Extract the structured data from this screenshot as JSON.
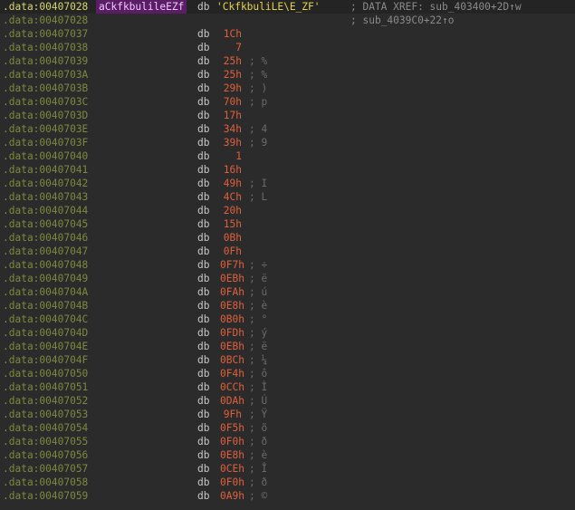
{
  "colors": {
    "background": "#2b2b2b",
    "address": "#7c8a3e",
    "label_bg": "#5b1d66",
    "string": "#e6d34a",
    "value": "#e0603c",
    "comment": "#6b6b6b"
  },
  "header_rows": [
    {
      "addr": ".data:00407028",
      "label": "aCkfkbulileEZf",
      "kw": "db",
      "str": "'CkfkbuliLE\\E_ZF'",
      "xref": "; DATA XREF: sub_403400+2D↑w"
    },
    {
      "addr": ".data:00407028",
      "label": "",
      "kw": "",
      "str": "",
      "xref": "; sub_4039C0+22↑o"
    }
  ],
  "rows": [
    {
      "addr": ".data:00407037",
      "kw": "db",
      "val": "1Ch",
      "cmt": ""
    },
    {
      "addr": ".data:00407038",
      "kw": "db",
      "val": "7",
      "cmt": ""
    },
    {
      "addr": ".data:00407039",
      "kw": "db",
      "val": "25h",
      "cmt": "; %"
    },
    {
      "addr": ".data:0040703A",
      "kw": "db",
      "val": "25h",
      "cmt": "; %"
    },
    {
      "addr": ".data:0040703B",
      "kw": "db",
      "val": "29h",
      "cmt": "; )"
    },
    {
      "addr": ".data:0040703C",
      "kw": "db",
      "val": "70h",
      "cmt": "; p"
    },
    {
      "addr": ".data:0040703D",
      "kw": "db",
      "val": "17h",
      "cmt": ""
    },
    {
      "addr": ".data:0040703E",
      "kw": "db",
      "val": "34h",
      "cmt": "; 4"
    },
    {
      "addr": ".data:0040703F",
      "kw": "db",
      "val": "39h",
      "cmt": "; 9"
    },
    {
      "addr": ".data:00407040",
      "kw": "db",
      "val": "1",
      "cmt": ""
    },
    {
      "addr": ".data:00407041",
      "kw": "db",
      "val": "16h",
      "cmt": ""
    },
    {
      "addr": ".data:00407042",
      "kw": "db",
      "val": "49h",
      "cmt": "; I"
    },
    {
      "addr": ".data:00407043",
      "kw": "db",
      "val": "4Ch",
      "cmt": "; L"
    },
    {
      "addr": ".data:00407044",
      "kw": "db",
      "val": "20h",
      "cmt": ""
    },
    {
      "addr": ".data:00407045",
      "kw": "db",
      "val": "15h",
      "cmt": ""
    },
    {
      "addr": ".data:00407046",
      "kw": "db",
      "val": "0Bh",
      "cmt": ""
    },
    {
      "addr": ".data:00407047",
      "kw": "db",
      "val": "0Fh",
      "cmt": ""
    },
    {
      "addr": ".data:00407048",
      "kw": "db",
      "val": "0F7h",
      "cmt": "; ÷"
    },
    {
      "addr": ".data:00407049",
      "kw": "db",
      "val": "0EBh",
      "cmt": "; ë"
    },
    {
      "addr": ".data:0040704A",
      "kw": "db",
      "val": "0FAh",
      "cmt": "; ú"
    },
    {
      "addr": ".data:0040704B",
      "kw": "db",
      "val": "0E8h",
      "cmt": "; è"
    },
    {
      "addr": ".data:0040704C",
      "kw": "db",
      "val": "0B0h",
      "cmt": "; °"
    },
    {
      "addr": ".data:0040704D",
      "kw": "db",
      "val": "0FDh",
      "cmt": "; ý"
    },
    {
      "addr": ".data:0040704E",
      "kw": "db",
      "val": "0EBh",
      "cmt": "; ë"
    },
    {
      "addr": ".data:0040704F",
      "kw": "db",
      "val": "0BCh",
      "cmt": "; ¼"
    },
    {
      "addr": ".data:00407050",
      "kw": "db",
      "val": "0F4h",
      "cmt": "; ô"
    },
    {
      "addr": ".data:00407051",
      "kw": "db",
      "val": "0CCh",
      "cmt": "; Ì"
    },
    {
      "addr": ".data:00407052",
      "kw": "db",
      "val": "0DAh",
      "cmt": "; Ú"
    },
    {
      "addr": ".data:00407053",
      "kw": "db",
      "val": "9Fh",
      "cmt": "; Ÿ"
    },
    {
      "addr": ".data:00407054",
      "kw": "db",
      "val": "0F5h",
      "cmt": "; õ"
    },
    {
      "addr": ".data:00407055",
      "kw": "db",
      "val": "0F0h",
      "cmt": "; ð"
    },
    {
      "addr": ".data:00407056",
      "kw": "db",
      "val": "0E8h",
      "cmt": "; è"
    },
    {
      "addr": ".data:00407057",
      "kw": "db",
      "val": "0CEh",
      "cmt": "; Î"
    },
    {
      "addr": ".data:00407058",
      "kw": "db",
      "val": "0F0h",
      "cmt": "; ð"
    },
    {
      "addr": ".data:00407059",
      "kw": "db",
      "val": "0A9h",
      "cmt": "; ©"
    }
  ]
}
